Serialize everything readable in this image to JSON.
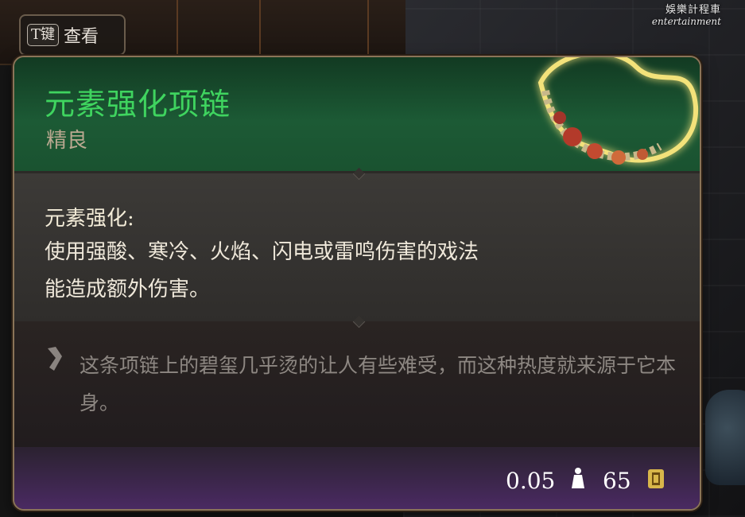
{
  "watermark": {
    "line1": "娛樂計程車",
    "line2": "entertainment"
  },
  "key_hint": {
    "key": "T键",
    "action": "查看"
  },
  "item": {
    "name": "元素强化项链",
    "rarity": "精良",
    "effect_title": "元素强化:",
    "effect_desc": "使用强酸、寒冷、火焰、闪电或雷鸣伤害的戏法能造成额外伤害。",
    "flavor": "这条项链上的碧玺几乎烫的让人有些难受，而这种热度就来源于它本身。",
    "weight": "0.05",
    "price": "65"
  },
  "colors": {
    "name": "#3fd45f",
    "rarity": "#b9a890",
    "header_bg": "#1c5a35",
    "footer_bg": "#4a2a62"
  },
  "icons": {
    "weight": "weight-icon",
    "price": "gold-coin-icon",
    "flavor": "quote-icon"
  }
}
